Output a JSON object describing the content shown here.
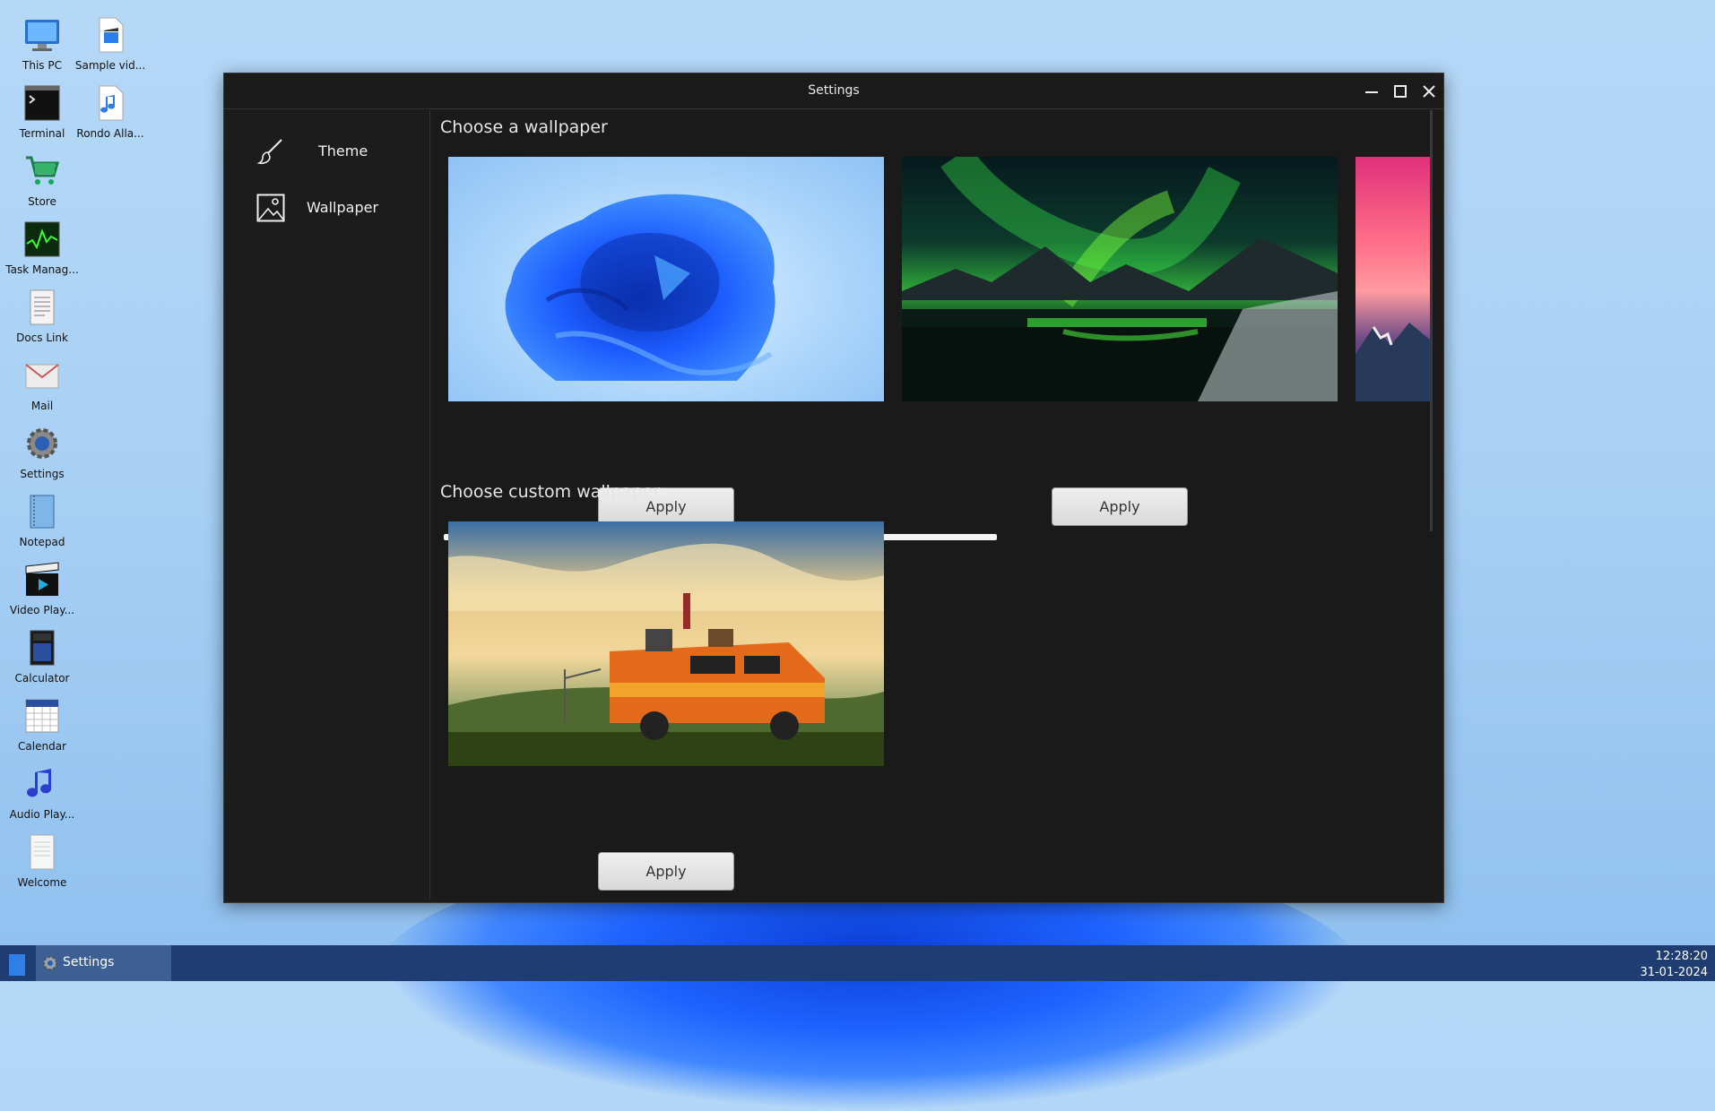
{
  "desktop": {
    "icons": [
      {
        "label": "This PC",
        "icon": "computer-icon"
      },
      {
        "label": "Sample vid...",
        "icon": "video-file-icon"
      },
      {
        "label": "Terminal",
        "icon": "terminal-icon"
      },
      {
        "label": "Rondo Alla...",
        "icon": "audio-file-icon"
      },
      {
        "label": "Store",
        "icon": "store-cart-icon"
      },
      {
        "label": "Task Manag...",
        "icon": "task-manager-icon"
      },
      {
        "label": "Docs Link",
        "icon": "document-icon"
      },
      {
        "label": "Mail",
        "icon": "mail-icon"
      },
      {
        "label": "Settings",
        "icon": "gear-icon"
      },
      {
        "label": "Notepad",
        "icon": "notepad-icon"
      },
      {
        "label": "Video Play...",
        "icon": "clapperboard-icon"
      },
      {
        "label": "Calculator",
        "icon": "calculator-icon"
      },
      {
        "label": "Calendar",
        "icon": "calendar-icon"
      },
      {
        "label": "Audio Play...",
        "icon": "music-note-icon"
      },
      {
        "label": "Welcome",
        "icon": "text-file-icon"
      }
    ]
  },
  "window": {
    "title": "Settings",
    "controls": [
      "minimize-icon",
      "maximize-icon",
      "close-icon"
    ]
  },
  "sidebar": {
    "items": [
      {
        "label": "Theme",
        "icon": "paintbrush-icon"
      },
      {
        "label": "Wallpaper",
        "icon": "image-icon"
      }
    ]
  },
  "main": {
    "wallpapers_title": "Choose a wallpaper",
    "custom_title": "Choose custom wallpaper",
    "apply_label": "Apply"
  },
  "taskbar": {
    "active_app": "Settings",
    "time": "12:28:20",
    "date": "31-01-2024"
  },
  "colors": {
    "window_bg": "#1c1c1c",
    "taskbar": "#1f3c73",
    "desktop": "#a9d1f5"
  }
}
